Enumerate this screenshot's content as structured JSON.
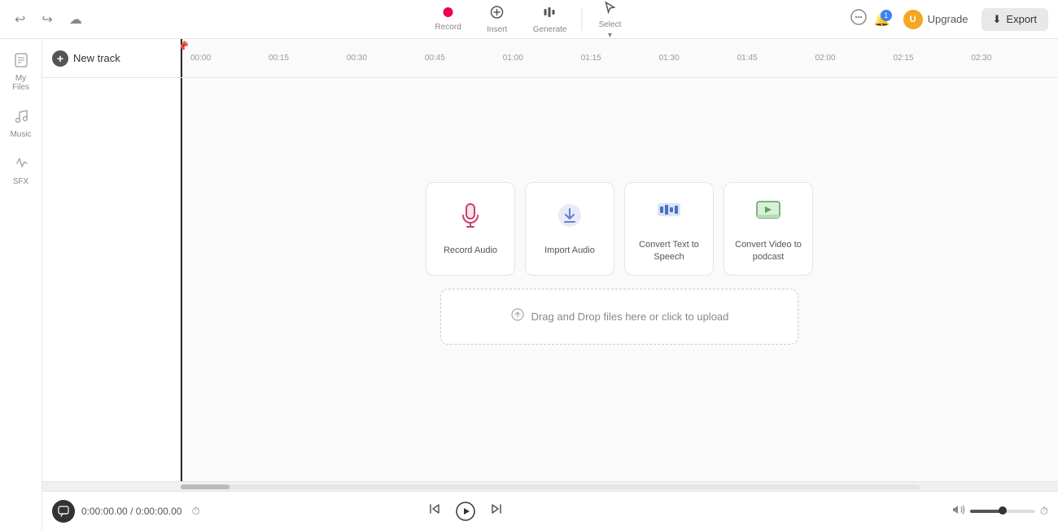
{
  "topbar": {
    "undo_label": "↩",
    "redo_label": "↪",
    "cloud_label": "☁",
    "tools": [
      {
        "id": "record",
        "label": "Record",
        "icon": "●",
        "active": true
      },
      {
        "id": "insert",
        "label": "Insert",
        "icon": "⊕"
      },
      {
        "id": "generate",
        "label": "Generate",
        "icon": "⬡"
      },
      {
        "id": "select",
        "label": "Select",
        "icon": "▷"
      }
    ],
    "chat_icon": "💬",
    "notification_count": "1",
    "upgrade_label": "Upgrade",
    "avatar_initials": "U",
    "export_label": "Export",
    "export_icon": "⬇"
  },
  "sidebar": {
    "items": [
      {
        "id": "my-files",
        "label": "My Files",
        "icon": "📄"
      },
      {
        "id": "music",
        "label": "Music",
        "icon": "🎵"
      },
      {
        "id": "sfx",
        "label": "SFX",
        "icon": "✨"
      }
    ]
  },
  "timeline": {
    "new_track_label": "New track",
    "ticks": [
      "00:00",
      "00:15",
      "00:30",
      "00:45",
      "01:00",
      "01:15",
      "01:30",
      "01:45",
      "02:00",
      "02:15",
      "02:30"
    ]
  },
  "cards": [
    {
      "id": "record-audio",
      "label": "Record Audio",
      "icon": "🎤",
      "icon_class": "card-icon-mic"
    },
    {
      "id": "import-audio",
      "label": "Import Audio",
      "icon": "⬆",
      "icon_class": "card-icon-import"
    },
    {
      "id": "convert-tts",
      "label": "Convert Text to Speech",
      "icon": "📊",
      "icon_class": "card-icon-tts"
    },
    {
      "id": "convert-video",
      "label": "Convert Video to podcast",
      "icon": "📺",
      "icon_class": "card-icon-video"
    }
  ],
  "dropzone": {
    "label": "Drag and Drop files here or click to upload"
  },
  "bottombar": {
    "time_current": "0:00:00.00",
    "time_total": "0:00:00.00",
    "time_separator": "/"
  }
}
